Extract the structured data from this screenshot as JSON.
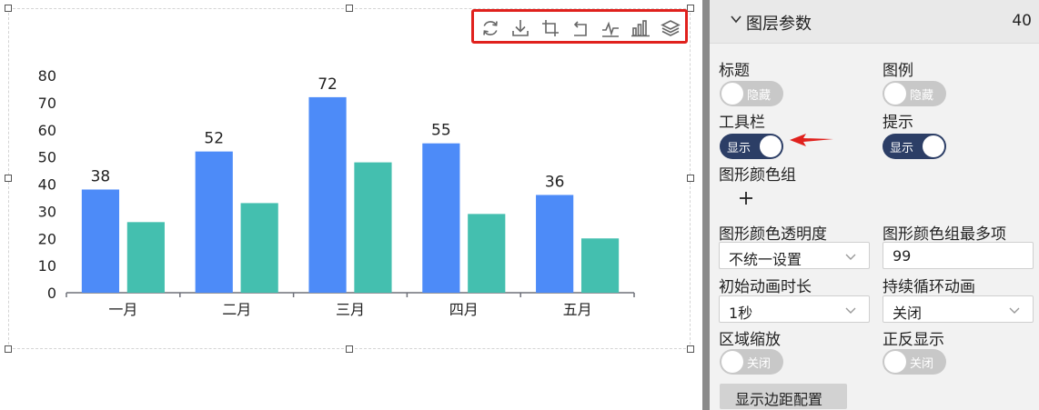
{
  "chart_data": {
    "type": "bar",
    "categories": [
      "一月",
      "二月",
      "三月",
      "四月",
      "五月"
    ],
    "series": [
      {
        "values": [
          38,
          52,
          72,
          55,
          36
        ],
        "color": "#4d8bf8",
        "show_labels": true
      },
      {
        "values": [
          26,
          33,
          48,
          29,
          20
        ],
        "color": "#44bfaf",
        "show_labels": false
      }
    ],
    "yticks": [
      "0",
      "10",
      "20",
      "30",
      "40",
      "50",
      "60",
      "70",
      "80"
    ],
    "ylim": [
      0,
      80
    ],
    "legend": "none",
    "grid": false
  },
  "chart_toolbar": {
    "highlight_color": "#e0211d",
    "icons": [
      "refresh-icon",
      "download-icon",
      "crop-icon",
      "undo-icon",
      "line-chart-icon",
      "bar-chart-icon",
      "layers-icon"
    ]
  },
  "panel": {
    "title": "图层参数",
    "number": "40",
    "title_toggle": {
      "label": "标题",
      "state": "隐藏"
    },
    "legend_toggle": {
      "label": "图例",
      "state": "隐藏"
    },
    "toolbar_toggle": {
      "label": "工具栏",
      "state": "显示"
    },
    "tooltip_toggle": {
      "label": "提示",
      "state": "显示"
    },
    "color_group_label": "图形颜色组",
    "opacity": {
      "label": "图形颜色透明度",
      "value": "不统一设置"
    },
    "max_colors": {
      "label": "图形颜色组最多项",
      "value": "99"
    },
    "anim_duration": {
      "label": "初始动画时长",
      "value": "1秒"
    },
    "loop_anim": {
      "label": "持续循环动画",
      "value": "关闭"
    },
    "zoom_toggle": {
      "label": "区域缩放",
      "state": "关闭"
    },
    "inverse_toggle": {
      "label": "正反显示",
      "state": "关闭"
    },
    "margin_button": "显示边距配置"
  },
  "colors": {
    "toggle_on": "#2c3e66",
    "toggle_off": "#c8c8c8",
    "arrow": "#e0211d"
  }
}
